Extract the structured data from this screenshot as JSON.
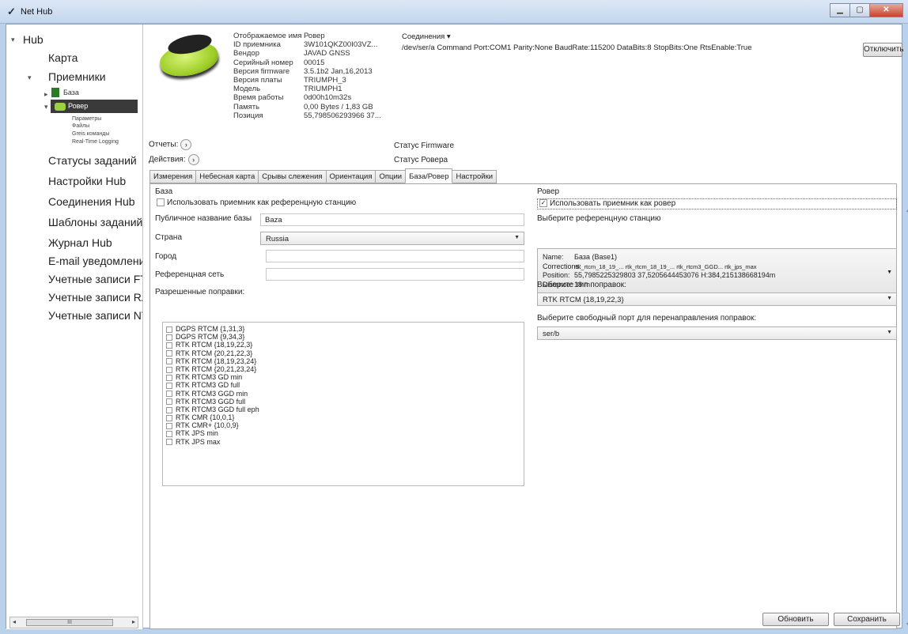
{
  "window": {
    "title": "Net Hub",
    "icon": "nethub-logo-icon"
  },
  "nav": {
    "hub": "Hub",
    "map": "Карта",
    "receivers": "Приемники",
    "base": "База",
    "rover": "Ровер",
    "rover_children": [
      "Параметры",
      "Файлы",
      "Greis команды",
      "Real-Time Logging"
    ],
    "items": [
      "Статусы заданий",
      "Настройки Hub",
      "Соединения Hub",
      "Шаблоны заданий",
      "Журнал Hub",
      "E-mail уведомления",
      "Учетные записи FTP",
      "Учетные записи RAW",
      "Учетные записи NTRIP"
    ],
    "scroll_label": "III"
  },
  "device": {
    "labels": [
      "Отображаемое имя",
      "ID приемника",
      "Вендор",
      "Серийный номер",
      "Версия firmware",
      "Версия платы",
      "Модель",
      "Время работы",
      "Память",
      "Позиция"
    ],
    "values": [
      "Ровер",
      "3W101QKZ00I03VZ...",
      "JAVAD GNSS",
      "00015",
      "3.5.1b2 Jan,16,2013",
      "TRIUMPH_3",
      "TRIUMPH1",
      "0d00h10m32s",
      "0,00 Bytes / 1,83 GB",
      "55,798506293966 37..."
    ]
  },
  "connections": {
    "header": "Соединения ▾",
    "line": "/dev/ser/a Command Port:COM1 Parity:None BaudRate:115200 DataBits:8 StopBits:One RtsEnable:True",
    "disconnect": "Отключить"
  },
  "reports": "Отчеты:",
  "actions": "Действия:",
  "firmware_status": "Статус Firmware",
  "rover_status": "Статус Ровера",
  "tabs": [
    "Измерения",
    "Небесная карта",
    "Срывы слежения",
    "Ориентация",
    "Опции",
    "База/Ровер",
    "Настройки"
  ],
  "active_tab": "База/Ровер",
  "base_panel": {
    "title": "База",
    "use_as_ref": "Использовать приемник как референцную станцию",
    "public_name_label": "Публичное название базы",
    "public_name_value": "Baza",
    "country_label": "Страна",
    "country_value": "Russia",
    "city_label": "Город",
    "city_value": "",
    "network_label": "Референцная сеть",
    "network_value": "",
    "allowed_label": "Разрешенные поправки:",
    "corrections": [
      "DGPS RTCM {1,31,3}",
      "DGPS RTCM {9,34,3}",
      "RTK RTCM {18,19,22,3}",
      "RTK RTCM {20,21,22,3}",
      "RTK RTCM {18,19,23,24}",
      "RTK RTCM {20,21,23,24}",
      "RTK RTCM3 GD min",
      "RTK RTCM3 GD full",
      "RTK RTCM3 GGD min",
      "RTK RTCM3 GGD full",
      "RTK RTCM3 GGD full eph",
      "RTK CMR {10,0,1}",
      "RTK CMR+ {10,0,9}",
      "RTK JPS min",
      "RTK JPS max"
    ]
  },
  "rover_panel": {
    "title": "Ровер",
    "use_as_rover": "Использовать приемник как ровер",
    "use_as_rover_checked": true,
    "select_station_label": "Выберите референцную станцию",
    "station": {
      "name_k": "Name:",
      "name_v": "Базa (Base1)",
      "corr_k": "Corrections:",
      "corr_v": "rtk_rtcm_18_19_...  rtk_rtcm_18_19_...  rtk_rtcm3_GGD...  rtk_jps_max",
      "pos_k": "Position:",
      "pos_v": "55,7985225329803 37,5205644453076 H:384,215138668194m",
      "dist_k": "Distance:",
      "dist_v": "18 m"
    },
    "corr_type_label": "Выберите тип поправок:",
    "corr_type_value": "RTK RTCM {18,19,22,3}",
    "port_label": "Выберите свободный порт для перенаправления поправок:",
    "port_value": "ser/b"
  },
  "footer": {
    "refresh": "Обновить",
    "save": "Сохранить"
  },
  "colors": {
    "selection": "#3a3a3a",
    "accent_green": "#9bd23c",
    "window_bg": "#b9d1ea"
  }
}
